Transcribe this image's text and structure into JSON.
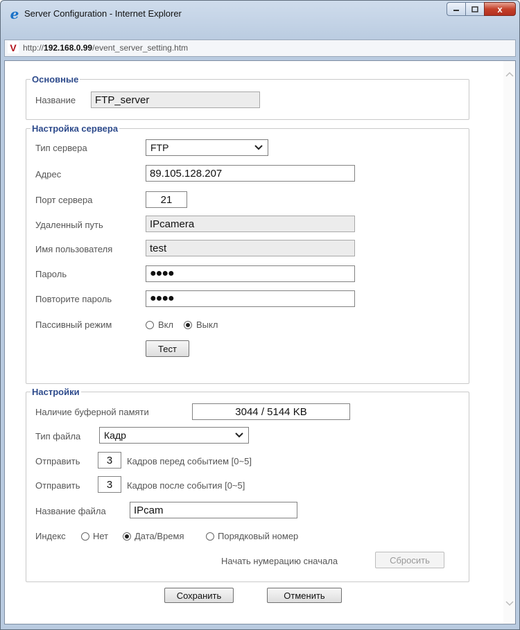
{
  "window": {
    "title": "Server Configuration - Internet Explorer",
    "close_glyph": "x"
  },
  "address": {
    "scheme": "http://",
    "host": "192.168.0.99",
    "path": "/event_server_setting.htm"
  },
  "basic": {
    "legend": "Основные",
    "name_label": "Название",
    "name_value": "FTP_server"
  },
  "server": {
    "legend": "Настройка сервера",
    "type_label": "Тип сервера",
    "type_value": "FTP",
    "address_label": "Адрес",
    "address_value": "89.105.128.207",
    "port_label": "Порт сервера",
    "port_value": "21",
    "remote_path_label": "Удаленный путь",
    "remote_path_value": "IPcamera",
    "username_label": "Имя пользователя",
    "username_value": "test",
    "password_label": "Пароль",
    "password_mask": "●●●●",
    "password_confirm_label": "Повторите пароль",
    "password_confirm_mask": "●●●●",
    "passive_label": "Пассивный режим",
    "passive_on_label": "Вкл",
    "passive_off_label": "Выкл",
    "passive_selected": "off",
    "test_button": "Тест"
  },
  "settings": {
    "legend": "Настройки",
    "buffer_label": "Наличие буферной памяти",
    "buffer_value": "3044 / 5144 KB",
    "file_type_label": "Тип файла",
    "file_type_value": "Кадр",
    "send_label": "Отправить",
    "pre_event_count": "3",
    "pre_event_text": "Кадров перед событием [0~5]",
    "post_event_count": "3",
    "post_event_text": "Кадров после события [0~5]",
    "file_name_label": "Название файла",
    "file_name_value": "IPcam",
    "index_label": "Индекс",
    "index_none": "Нет",
    "index_datetime": "Дата/Время",
    "index_sequence": "Порядковый номер",
    "index_selected": "datetime",
    "restart_numbering_label": "Начать нумерацию сначала",
    "reset_button": "Сбросить"
  },
  "footer": {
    "save_button": "Сохранить",
    "cancel_button": "Отменить"
  }
}
